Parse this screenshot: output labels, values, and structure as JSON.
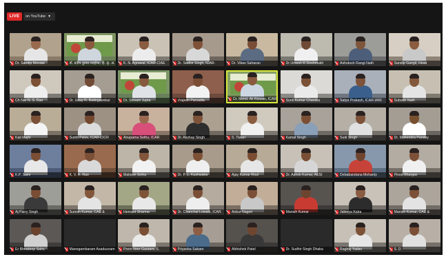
{
  "live": {
    "badge": "LIVE",
    "target": "on YouTube"
  },
  "colors": {
    "live_red": "#e02828",
    "active_speaker_border": "#d9e83a",
    "background": "#151515"
  },
  "participants": [
    {
      "name": "Dr. Sandip Mondal",
      "bg": "#8a7a68",
      "wall": "#b0a28c",
      "skin": "#9a6a4e",
      "shirt": "#e6e6e6",
      "banner": false
    },
    {
      "name": "डॉ. प्रदीप कुमार मल्होत्रा, हि. कृ. अ. सं.",
      "bg": "#6a7f55",
      "wall": "#7d9460",
      "skin": "#8b5a3e",
      "shirt": "#cfd6de",
      "banner": true
    },
    {
      "name": "K. N. Agrawal, ICAR-CIAE",
      "bg": "#7e7a72",
      "wall": "#c9c2b5",
      "skin": "#8a5c40",
      "shirt": "#ececec",
      "banner": false
    },
    {
      "name": "Dr. Sudhir Singh, ICAR-",
      "bg": "#6e665e",
      "wall": "#a59a8c",
      "skin": "#7f5238",
      "shirt": "#d8d8d8",
      "banner": false
    },
    {
      "name": "Dr. Vikas Saharan",
      "bg": "#6b6357",
      "wall": "#c8b9a0",
      "skin": "#7a4e36",
      "shirt": "#5b6b82",
      "banner": false
    },
    {
      "name": "Dr Umesh R Deshmukh",
      "bg": "#7a7a72",
      "wall": "#bdbab0",
      "skin": "#6f4a36",
      "shirt": "#f0f0f0",
      "banner": false
    },
    {
      "name": "Ashutosh Rangi Nath",
      "bg": "#6d6d6d",
      "wall": "#9c9c98",
      "skin": "#7e563c",
      "shirt": "#4c5e7a",
      "banner": false
    },
    {
      "name": "Sandip Gangil, Head",
      "bg": "#8f8478",
      "wall": "#d7cfc3",
      "skin": "#8b5c40",
      "shirt": "#c9c9c9",
      "banner": false
    },
    {
      "name": "Ch Nar N. S. Rao",
      "bg": "#7d7a74",
      "wall": "#cfc8bd",
      "skin": "#7c5034",
      "shirt": "#eeeeee",
      "banner": false
    },
    {
      "name": "Dr. Uday R. Badegaonkar",
      "bg": "#5f5a54",
      "wall": "#a69d92",
      "skin": "#714b36",
      "shirt": "#ffffff",
      "banner": false
    },
    {
      "name": "Dr. Shivam Jupta",
      "bg": "#68805a",
      "wall": "#7b9566",
      "skin": "#86593e",
      "shirt": "#dfe3e8",
      "banner": true
    },
    {
      "name": "Vrajesh Parvadia",
      "bg": "#6d4a3e",
      "wall": "#8e5f4c",
      "skin": "#7a4d34",
      "shirt": "#f2f2f2",
      "banner": false
    },
    {
      "name": "Dr. Mohd. Ali Rizwan, ICAR",
      "bg": "#6a8052",
      "wall": "#86a064",
      "skin": "#8a5b3f",
      "shirt": "#ccd7e2",
      "banner": true
    },
    {
      "name": "Sunil Kumar Chandra",
      "bg": "#8b8a86",
      "wall": "#dcdad6",
      "skin": "#7c5136",
      "shirt": "#eaeaea",
      "banner": false
    },
    {
      "name": "Satya Prakash, ICAR-IARI",
      "bg": "#6f7681",
      "wall": "#a9b0ba",
      "skin": "#7e5339",
      "shirt": "#3b5f8c",
      "banner": false
    },
    {
      "name": "Subodh Nath",
      "bg": "#7f7a70",
      "wall": "#c7c0b2",
      "skin": "#83573b",
      "shirt": "#e4e4e4",
      "banner": false
    },
    {
      "name": "Kali Majhi",
      "bg": "#7a7264",
      "wall": "#b9ad98",
      "skin": "#7b5036",
      "shirt": "#f4f4f4",
      "banner": false
    },
    {
      "name": "Sumit Palve, ICAR-CICR",
      "bg": "#665e56",
      "wall": "#9d9184",
      "skin": "#74482f",
      "shirt": "#dcdcdc",
      "banner": false
    },
    {
      "name": "Anupama Sethu, ICAR",
      "bg": "#8a7666",
      "wall": "#c8b29e",
      "skin": "#9a6a50",
      "shirt": "#d84f7a",
      "banner": false
    },
    {
      "name": "Dr. Akshay Singh",
      "bg": "#726a60",
      "wall": "#aca091",
      "skin": "#7d5237",
      "shirt": "#2e2e2e",
      "banner": false
    },
    {
      "name": "S. Tiwari",
      "bg": "#7c7770",
      "wall": "#d0c9be",
      "skin": "#8a5d41",
      "shirt": "#f0f0f0",
      "banner": false
    },
    {
      "name": "Kamal Singh",
      "bg": "#6f6a64",
      "wall": "#a8a29a",
      "skin": "#7b4f35",
      "shirt": "#8a9fb8",
      "banner": false
    },
    {
      "name": "Sudi Singh",
      "bg": "#74706a",
      "wall": "#b5afa6",
      "skin": "#7d5238",
      "shirt": "#e0e0e0",
      "banner": false
    },
    {
      "name": "Dr. Mahendra Pandey",
      "bg": "#6a6560",
      "wall": "#a49d94",
      "skin": "#78502f",
      "shirt": "#ffffff",
      "banner": false
    },
    {
      "name": "K.P. Saini",
      "bg": "#4e5c78",
      "wall": "#6e7f9e",
      "skin": "#7a4f36",
      "shirt": "#e8e8e8",
      "banner": false
    },
    {
      "name": "K. V. R. Rao",
      "bg": "#6f4e3a",
      "wall": "#9a6a4e",
      "skin": "#7c5036",
      "shirt": "#d9d9d9",
      "banner": false
    },
    {
      "name": "Mahesh Sinha",
      "bg": "#7a756d",
      "wall": "#bdb5a8",
      "skin": "#82563b",
      "shirt": "#f2f2f2",
      "banner": false
    },
    {
      "name": "Dr. P. L. Kushwaha",
      "bg": "#6b6258",
      "wall": "#a89b8b",
      "skin": "#7d5136",
      "shirt": "#efefef",
      "banner": false
    },
    {
      "name": "Ajay Kumar Roul",
      "bg": "#776e62",
      "wall": "#b7aa97",
      "skin": "#7b4e34",
      "shirt": "#e6e6e6",
      "banner": false
    },
    {
      "name": "Dr. Ashok Kumar, AESI",
      "bg": "#7b7670",
      "wall": "#c7c1b8",
      "skin": "#7a4f35",
      "shirt": "#d6d6d6",
      "banner": false
    },
    {
      "name": "Debabandana Mohanty",
      "bg": "#5e6f82",
      "wall": "#8798ac",
      "skin": "#6f4530",
      "shirt": "#c7433a",
      "banner": false
    },
    {
      "name": "Pinod Bhargav",
      "bg": "#756f68",
      "wall": "#b3aca2",
      "skin": "#7d5137",
      "shirt": "#f0f0f0",
      "banner": false
    },
    {
      "name": "Aj Parry Singh",
      "bg": "#6a6a66",
      "wall": "#9e9e98",
      "skin": "#7a4e34",
      "shirt": "#3a3a3a",
      "banner": false
    },
    {
      "name": "Suresh Kumar, CAE &",
      "bg": "#7e766c",
      "wall": "#c3b8a8",
      "skin": "#83573b",
      "shirt": "#e4e4e4",
      "banner": false
    },
    {
      "name": "Hemant Sharma",
      "bg": "#6c7059",
      "wall": "#a3a786",
      "skin": "#7e5338",
      "shirt": "#e8e8e8",
      "banner": false
    },
    {
      "name": "Dr. Chanchal Lowatti, ICAR",
      "bg": "#756e66",
      "wall": "#b5ab9f",
      "skin": "#7a4f36",
      "shirt": "#eeeeee",
      "banner": false
    },
    {
      "name": "Ankur Nagori",
      "bg": "#7d6f63",
      "wall": "#c2ad98",
      "skin": "#7c5037",
      "shirt": "#c8c8c8",
      "banner": false
    },
    {
      "name": "Manish Kumar",
      "bg": "#3c3a38",
      "wall": "#575450",
      "skin": "#6d452f",
      "shirt": "#c83b32",
      "banner": false
    },
    {
      "name": "Jaleeya Kalra",
      "bg": "#7b7670",
      "wall": "#c9c2b9",
      "skin": "#8a5c42",
      "shirt": "#2c2c2c",
      "banner": false
    },
    {
      "name": "Manish Kumar, CAE &",
      "bg": "#716c66",
      "wall": "#aca59c",
      "skin": "#7c5137",
      "shirt": "#e3e3e3",
      "banner": false
    },
    {
      "name": "Er Bhradeep Sahu",
      "bg": "#3f3d3b",
      "wall": "#5b5855",
      "skin": "#6b432e",
      "shirt": "#d0d0d0",
      "banner": false
    },
    {
      "name": "Manogambaram Asaduzzam",
      "bg": "#2a2a2a",
      "wall": "#2a2a2a",
      "skin": "#2a2a2a",
      "shirt": "#2a2a2a",
      "banner": false
    },
    {
      "name": "Prem Veer Gautam, S.",
      "bg": "#7d766e",
      "wall": "#c0b7ac",
      "skin": "#7b4f35",
      "shirt": "#eaeaea",
      "banner": false
    },
    {
      "name": "Priyanka Sakare",
      "bg": "#6e6862",
      "wall": "#a69e95",
      "skin": "#8d5e44",
      "shirt": "#4a6b8a",
      "banner": false
    },
    {
      "name": "Abhishek Patel",
      "bg": "#3c3a38",
      "wall": "#55524e",
      "skin": "#6f4630",
      "shirt": "#383838",
      "banner": false
    },
    {
      "name": "Dr. Sudhir Singh Dhaka",
      "bg": "#2a2a2a",
      "wall": "#2a2a2a",
      "skin": "#2a2a2a",
      "shirt": "#2a2a2a",
      "banner": false
    },
    {
      "name": "Raghuj Yadav",
      "bg": "#7a756f",
      "wall": "#c6c0b7",
      "skin": "#7d5238",
      "shirt": "#e6e6e6",
      "banner": false
    },
    {
      "name": "S. D",
      "bg": "#767069",
      "wall": "#b8b0a6",
      "skin": "#7c5037",
      "shirt": "#e0e0e0",
      "banner": false
    }
  ]
}
